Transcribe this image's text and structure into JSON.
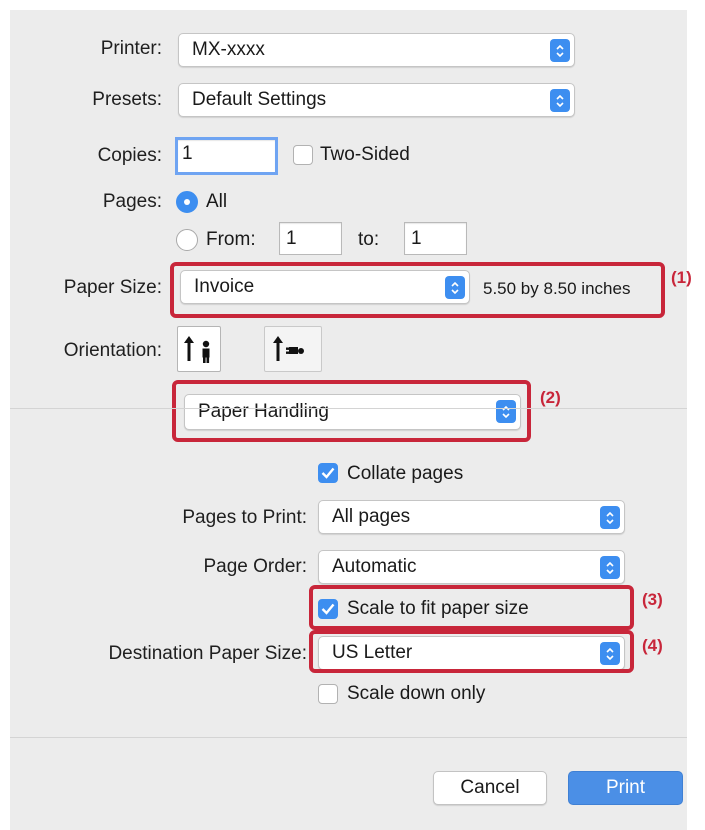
{
  "colors": {
    "accent": "#3d8ef0",
    "callout": "#c8263a",
    "dialog_bg": "#ececec"
  },
  "printer": {
    "label": "Printer:",
    "value": "MX-xxxx"
  },
  "presets": {
    "label": "Presets:",
    "value": "Default Settings"
  },
  "copies": {
    "label": "Copies:",
    "value": "1",
    "two_sided_label": "Two-Sided",
    "two_sided_checked": false
  },
  "pages": {
    "label": "Pages:",
    "all_label": "All",
    "from_label": "From:",
    "from_value": "1",
    "to_label": "to:",
    "to_value": "1",
    "selected": "All"
  },
  "paper_size": {
    "label": "Paper Size:",
    "value": "Invoice",
    "dimensions": "5.50 by 8.50 inches"
  },
  "orientation": {
    "label": "Orientation:",
    "options": [
      "portrait-icon",
      "landscape-icon"
    ],
    "selected": "portrait"
  },
  "section_popup": {
    "value": "Paper Handling"
  },
  "collate": {
    "label": "Collate pages",
    "checked": true
  },
  "pages_to_print": {
    "label": "Pages to Print:",
    "value": "All pages"
  },
  "page_order": {
    "label": "Page Order:",
    "value": "Automatic"
  },
  "scale_to_fit": {
    "label": "Scale to fit paper size",
    "checked": true
  },
  "destination_paper_size": {
    "label": "Destination Paper Size:",
    "value": "US Letter"
  },
  "scale_down_only": {
    "label": "Scale down only",
    "checked": false
  },
  "buttons": {
    "cancel": "Cancel",
    "print": "Print"
  },
  "callouts": [
    "(1)",
    "(2)",
    "(3)",
    "(4)"
  ]
}
